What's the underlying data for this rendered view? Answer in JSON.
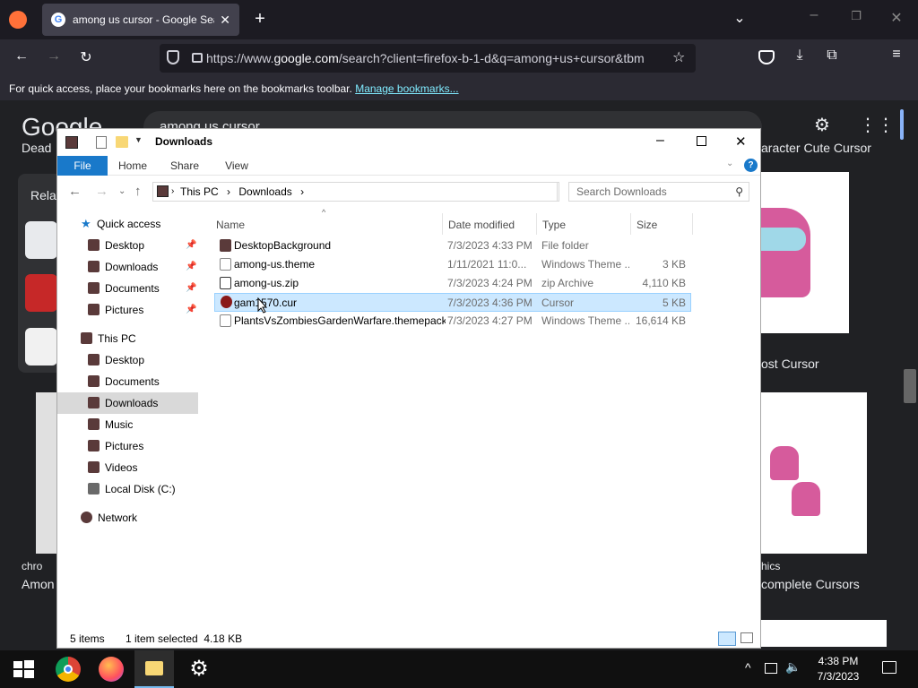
{
  "browser": {
    "tab_title": "among us cursor - Google Sea",
    "url_prefix": "https://www.",
    "url_domain": "google.com",
    "url_rest": "/search?client=firefox-b-1-d&q=among+us+cursor&tbm",
    "bookmarks_text": "For quick access, place your bookmarks here on the bookmarks toolbar.",
    "bookmarks_link": "Manage bookmarks..."
  },
  "google": {
    "logo": "Google",
    "query": "among us cursor",
    "related": "Relat",
    "left_caption_1": "Dead",
    "left_caption_2": "chro",
    "left_caption_3": "Amon",
    "right_caption_1": "aracter Cute Cursor",
    "right_caption_2": "ost Cursor",
    "right_caption_3": "hics",
    "right_caption_4": "complete Cursors"
  },
  "explorer": {
    "title": "Downloads",
    "ribbon": [
      "File",
      "Home",
      "Share",
      "View"
    ],
    "breadcrumb": [
      "This PC",
      "Downloads"
    ],
    "search_placeholder": "Search Downloads",
    "nav": {
      "quick_access": "Quick access",
      "qa_items": [
        "Desktop",
        "Downloads",
        "Documents",
        "Pictures"
      ],
      "this_pc": "This PC",
      "pc_items": [
        "Desktop",
        "Documents",
        "Downloads",
        "Music",
        "Pictures",
        "Videos",
        "Local Disk (C:)"
      ],
      "network": "Network"
    },
    "columns": [
      "Name",
      "Date modified",
      "Type",
      "Size"
    ],
    "files": [
      {
        "name": "DesktopBackground",
        "date": "7/3/2023 4:33 PM",
        "type": "File folder",
        "size": ""
      },
      {
        "name": "among-us.theme",
        "date": "1/11/2021 11:0...",
        "type": "Windows Theme ...",
        "size": "3 KB"
      },
      {
        "name": "among-us.zip",
        "date": "7/3/2023 4:24 PM",
        "type": "zip Archive",
        "size": "4,110 KB"
      },
      {
        "name": "gam1570.cur",
        "date": "7/3/2023 4:36 PM",
        "type": "Cursor",
        "size": "5 KB"
      },
      {
        "name": "PlantsVsZombiesGardenWarfare.themepack",
        "date": "7/3/2023 4:27 PM",
        "type": "Windows Theme ...",
        "size": "16,614 KB"
      }
    ],
    "status_items": "5 items",
    "status_selected": "1 item selected  4.18 KB"
  },
  "taskbar": {
    "time": "4:38 PM",
    "date": "7/3/2023"
  }
}
